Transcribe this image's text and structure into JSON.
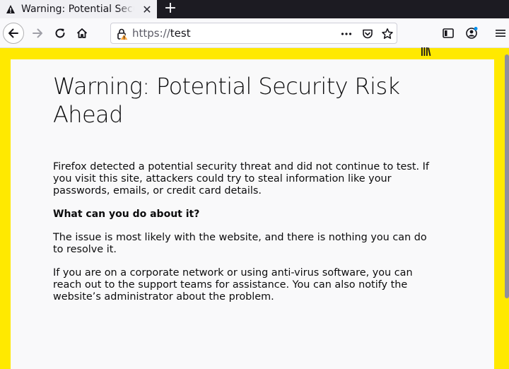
{
  "tab": {
    "title": "Warning: Potential Security Risk Ahead",
    "close_glyph": "✕",
    "new_tab_glyph": "+"
  },
  "urlbar": {
    "prefix": "https://",
    "host": "test"
  },
  "content": {
    "title": "Warning: Potential Security Risk Ahead",
    "intro": "Firefox detected a potential security threat and did not continue to test. If you visit this site, attackers could try to steal information like your passwords, emails, or credit card details.",
    "subheading": "What can you do about it?",
    "para1": "The issue is most likely with the website, and there is nothing you can do to resolve it.",
    "para2": "If you are on a corporate network or using anti-virus software, you can reach out to the support teams for assistance. You can also notify the website’s administrator about the problem."
  },
  "icons": {
    "tab": "warning-icon",
    "back": "back-arrow-icon",
    "forward": "forward-arrow-icon",
    "reload": "reload-icon",
    "home": "home-icon",
    "lock": "insecure-lock-icon",
    "page_actions": "more-actions-icon",
    "pocket": "pocket-icon",
    "bookmark": "star-icon",
    "library": "library-icon",
    "sidebar": "sidebar-icon",
    "account": "account-icon",
    "menu": "hamburger-menu-icon"
  },
  "colors": {
    "warning_border": "#ffe900",
    "page_background": "#f9f9fa",
    "tabbar": "#1c1b22",
    "badge": "#0090ed"
  }
}
